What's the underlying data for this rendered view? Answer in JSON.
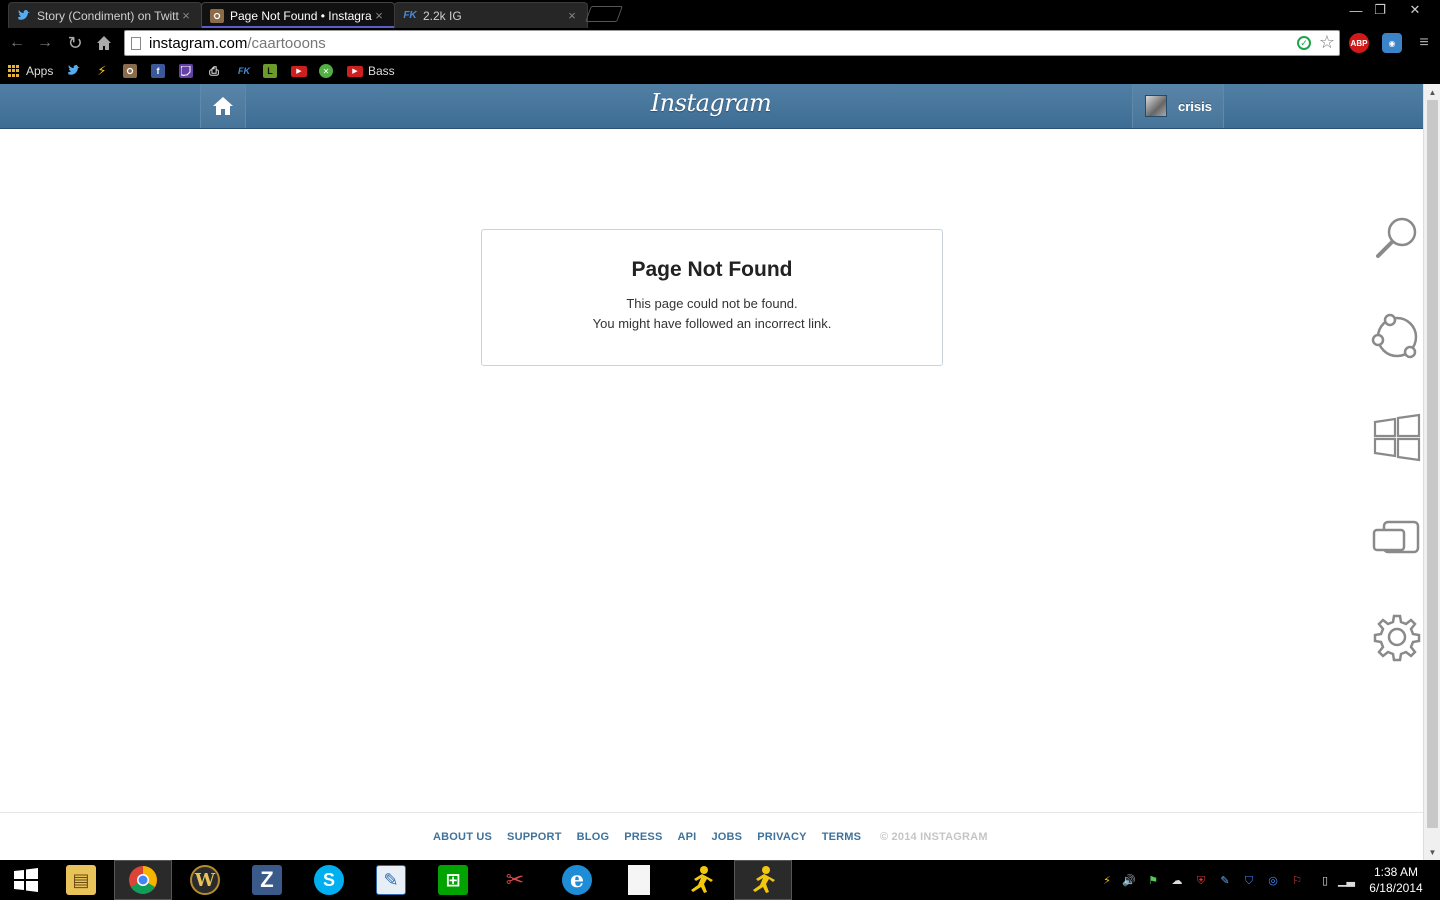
{
  "window": {
    "tabs": [
      {
        "title": "Story (Condiment) on Twitter",
        "favicon": "twitter-bird-icon"
      },
      {
        "title": "Page Not Found • Instagram",
        "favicon": "instagram-camera-icon",
        "active": true
      },
      {
        "title": "2.2k IG",
        "favicon": "fk-logo-icon",
        "favicon_text": "FK"
      }
    ],
    "controls": {
      "minimize": "—",
      "restore": "❐",
      "close": "✕"
    }
  },
  "toolbar": {
    "url_host": "instagram.com",
    "url_path": "/caartooons",
    "extensions": [
      {
        "name": "adblock-plus-icon",
        "label": "ABP",
        "color": "#d01a1a"
      },
      {
        "name": "extension-blue-icon",
        "label": "◉",
        "color": "#3d83c8"
      }
    ]
  },
  "bookmarks": [
    {
      "label": "Apps",
      "icon": "apps-grid-icon"
    },
    {
      "label": "",
      "icon": "twitter-icon",
      "color": "#1da1f2"
    },
    {
      "label": "",
      "icon": "aim-runner-icon",
      "color": "#f2c80f"
    },
    {
      "label": "",
      "icon": "instagram-icon",
      "color": "#8a6b4a"
    },
    {
      "label": "",
      "icon": "facebook-icon",
      "color": "#3b5998",
      "glyph": "f"
    },
    {
      "label": "",
      "icon": "twitch-icon",
      "color": "#6441a5"
    },
    {
      "label": "",
      "icon": "printer-icon",
      "color": "#666"
    },
    {
      "label": "",
      "icon": "fk-icon",
      "color": "#2b6cb0",
      "glyph": "FK"
    },
    {
      "label": "",
      "icon": "letterboxd-icon",
      "color": "#6b9c2b",
      "glyph": "L"
    },
    {
      "label": "",
      "icon": "youtube-icon",
      "color": "#cc1f1f",
      "glyph": "▶"
    },
    {
      "label": "",
      "icon": "xbox-icon",
      "color": "#52b043",
      "glyph": "✕"
    },
    {
      "label": "Bass",
      "icon": "youtube-icon",
      "color": "#cc1f1f",
      "glyph": "▶"
    }
  ],
  "instagram": {
    "logo": "Instagram",
    "username": "crisis",
    "error": {
      "title": "Page Not Found",
      "line1": "This page could not be found.",
      "line2": "You might have followed an incorrect link."
    },
    "footer": {
      "links": [
        "ABOUT US",
        "SUPPORT",
        "BLOG",
        "PRESS",
        "API",
        "JOBS",
        "PRIVACY",
        "TERMS"
      ],
      "copyright": "© 2014 INSTAGRAM"
    }
  },
  "charms": [
    "search-charm-icon",
    "share-charm-icon",
    "start-charm-icon",
    "devices-charm-icon",
    "settings-charm-icon"
  ],
  "taskbar": {
    "apps": [
      {
        "name": "file-explorer-icon",
        "color": "#e8c35a",
        "glyph": "▤"
      },
      {
        "name": "chrome-icon",
        "color": "#db4437",
        "glyph": "◉",
        "active": true
      },
      {
        "name": "world-of-warcraft-icon",
        "color": "#b58b2e",
        "glyph": "W"
      },
      {
        "name": "z-app-icon",
        "color": "#3a5a8a",
        "glyph": "Z"
      },
      {
        "name": "skype-icon",
        "color": "#00aff0",
        "glyph": "S"
      },
      {
        "name": "notepad-icon",
        "color": "#4a7fbf",
        "glyph": "✎"
      },
      {
        "name": "windows-store-icon",
        "color": "#00a300",
        "glyph": "⊞"
      },
      {
        "name": "snipping-tool-icon",
        "color": "#c0392b",
        "glyph": "✂"
      },
      {
        "name": "ie-icon",
        "color": "#1f8dd6",
        "glyph": "e"
      },
      {
        "name": "blank-document-icon",
        "color": "#f5f5f5",
        "glyph": ""
      },
      {
        "name": "aim-icon",
        "color": "#f2c80f",
        "glyph": "🏃"
      },
      {
        "name": "aim-icon-active",
        "color": "#f2c80f",
        "glyph": "🏃",
        "active": true
      }
    ],
    "clock_time": "1:38 AM",
    "clock_date": "6/18/2014"
  }
}
